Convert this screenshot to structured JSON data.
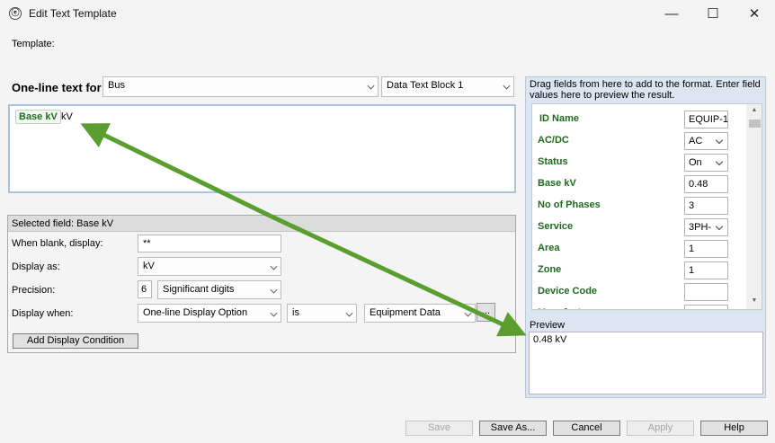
{
  "window": {
    "title": "Edit Text Template",
    "app_icon": "ⓔ",
    "minimize_icon": "—",
    "maximize_icon": "☐",
    "close_icon": "✕"
  },
  "template_label": "Template:",
  "oneline": {
    "label": "One-line text for",
    "object_select": "Bus",
    "block_select": "Data Text Block 1"
  },
  "format": {
    "field_chip": "Base kV",
    "unit_text": "kV"
  },
  "selected_field": {
    "header": "Selected field: Base kV",
    "when_blank_label": "When blank, display:",
    "when_blank_value": "**",
    "display_as_label": "Display as:",
    "display_as_value": "kV",
    "precision_label": "Precision:",
    "precision_value": "6",
    "precision_mode": "Significant digits",
    "display_when_label": "Display when:",
    "display_when_field": "One-line Display Option",
    "display_when_op": "is",
    "display_when_value": "Equipment Data",
    "ellipsis": "...",
    "add_condition_label": "Add Display Condition"
  },
  "fields_panel": {
    "hint": "Drag fields from here to add to the format.  Enter field values here to preview the result.",
    "fields": [
      {
        "name": "ID Name",
        "value": "EQUIP-1",
        "dropdown": false
      },
      {
        "name": "AC/DC",
        "value": "AC",
        "dropdown": true
      },
      {
        "name": "Status",
        "value": "On",
        "dropdown": true
      },
      {
        "name": "Base kV",
        "value": "0.48",
        "dropdown": false
      },
      {
        "name": "No of Phases",
        "value": "3",
        "dropdown": false
      },
      {
        "name": "Service",
        "value": "3PH-",
        "dropdown": true
      },
      {
        "name": "Area",
        "value": "1",
        "dropdown": false
      },
      {
        "name": "Zone",
        "value": "1",
        "dropdown": false
      },
      {
        "name": "Device Code",
        "value": "",
        "dropdown": false
      },
      {
        "name": "Manufacturer",
        "value": "",
        "dropdown": false
      }
    ],
    "scroll_up_icon": "▲",
    "scroll_down_icon": "▼"
  },
  "preview": {
    "label": "Preview",
    "text": "0.48 kV"
  },
  "buttons": {
    "save": "Save",
    "save_as": "Save As...",
    "cancel": "Cancel",
    "apply": "Apply",
    "help": "Help"
  },
  "colors": {
    "field_green": "#1f6a1f",
    "arrow_green": "#5a9e2f",
    "panel_blue": "#dbe6f2"
  }
}
